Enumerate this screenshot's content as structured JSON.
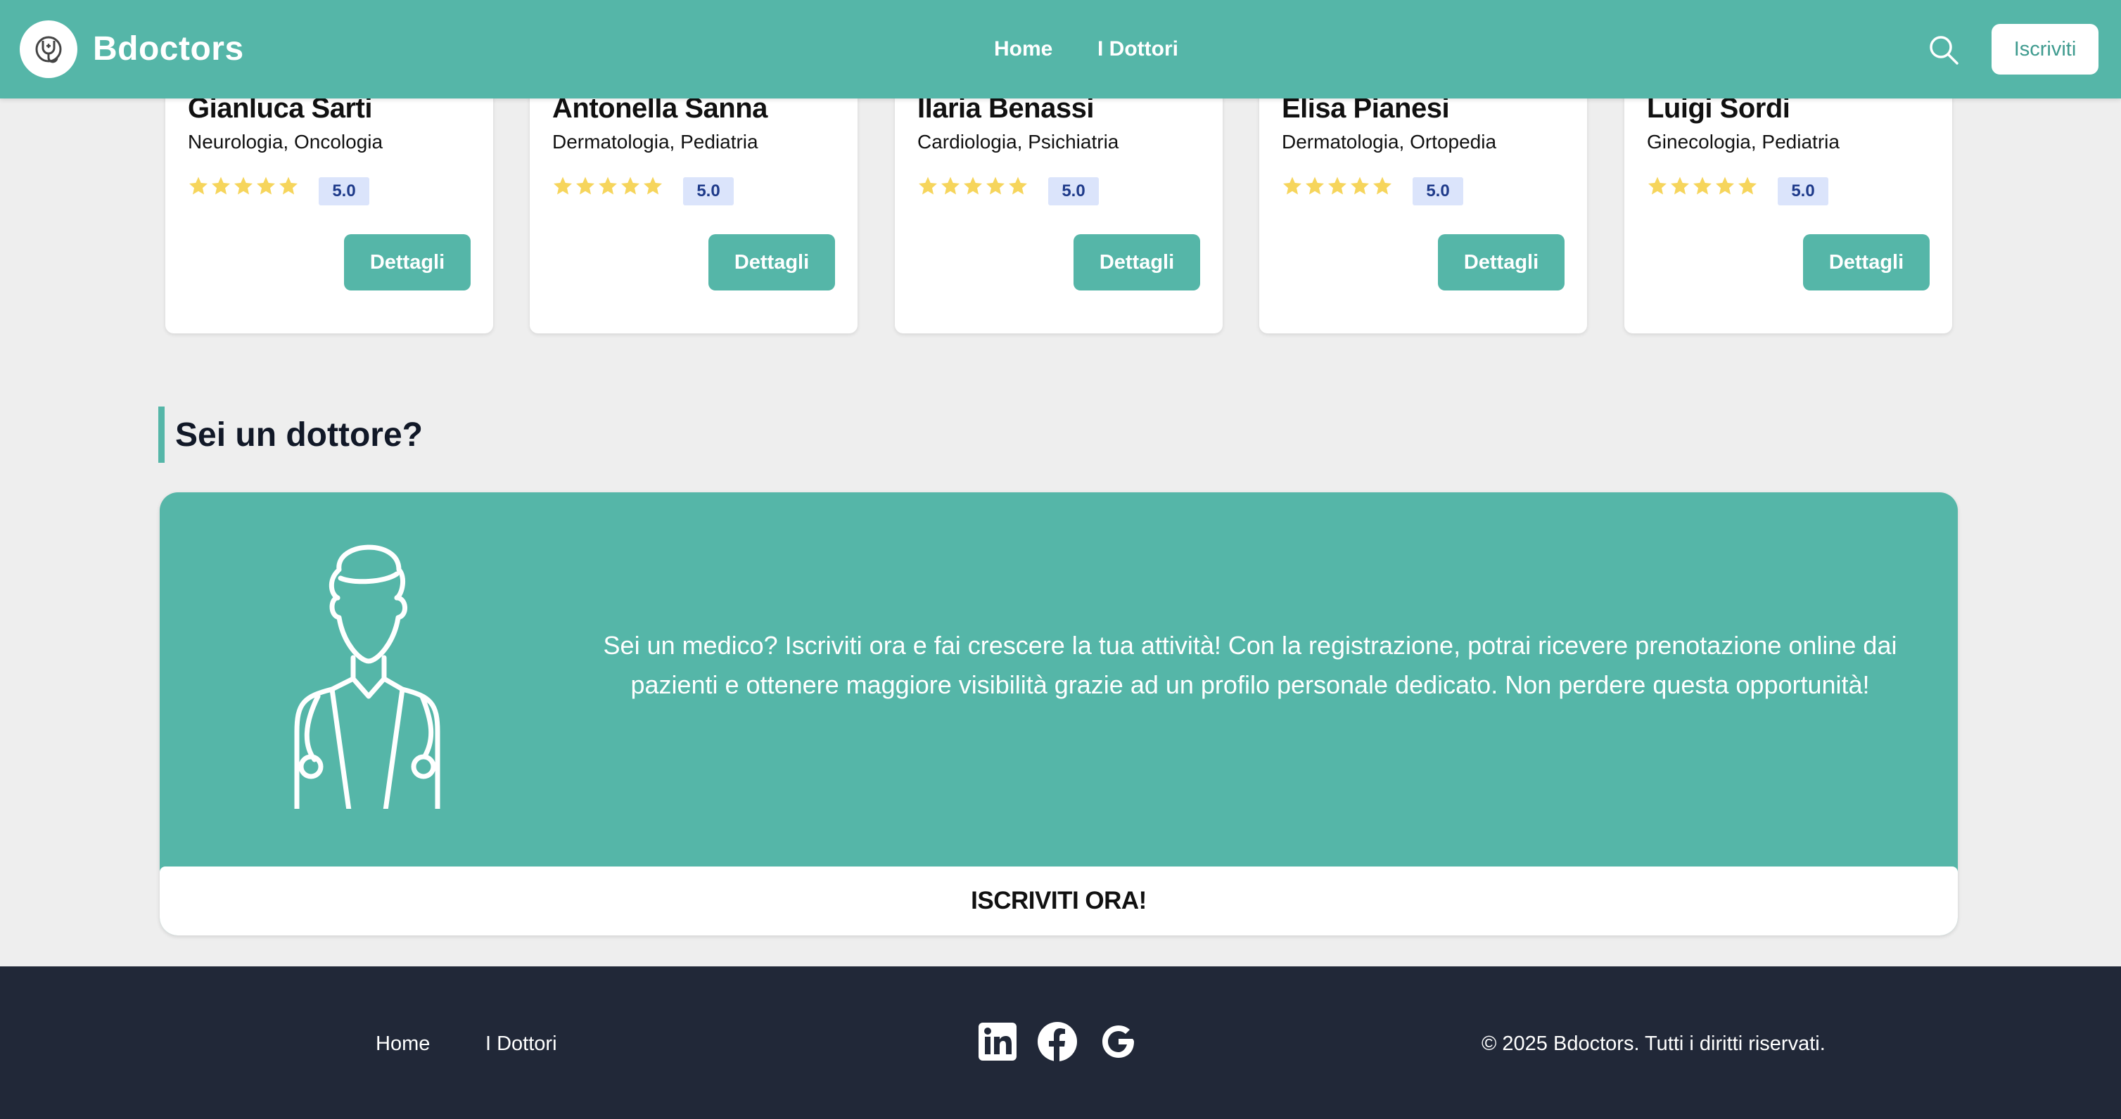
{
  "header": {
    "brand": "Bdoctors",
    "nav": [
      "Home",
      "I Dottori"
    ],
    "signup_label": "Iscriviti"
  },
  "doctors": [
    {
      "name": "Gianluca Sarti",
      "specialties": "Neurologia, Oncologia",
      "rating": "5.0",
      "stars": 5,
      "details_label": "Dettagli"
    },
    {
      "name": "Antonella Sanna",
      "specialties": "Dermatologia, Pediatria",
      "rating": "5.0",
      "stars": 5,
      "details_label": "Dettagli"
    },
    {
      "name": "Ilaria Benassi",
      "specialties": "Cardiologia, Psichiatria",
      "rating": "5.0",
      "stars": 5,
      "details_label": "Dettagli"
    },
    {
      "name": "Elisa Pianesi",
      "specialties": "Dermatologia, Ortopedia",
      "rating": "5.0",
      "stars": 5,
      "details_label": "Dettagli"
    },
    {
      "name": "Luigi Sordi",
      "specialties": "Ginecologia, Pediatria",
      "rating": "5.0",
      "stars": 5,
      "details_label": "Dettagli"
    }
  ],
  "promo": {
    "section_title": "Sei un dottore?",
    "text": "Sei un medico? Iscriviti ora e fai crescere la tua attività! Con la registrazione, potrai ricevere prenotazione online dai pazienti e ottenere maggiore visibilità grazie ad un profilo personale dedicato. Non perdere questa opportunità!",
    "cta_label": "ISCRIVITI ORA!"
  },
  "footer": {
    "links": [
      "Home",
      "I Dottori"
    ],
    "social_icons": [
      "linkedin-icon",
      "facebook-icon",
      "google-icon"
    ],
    "copyright": "© 2025 Bdoctors. Tutti i diritti riservati."
  },
  "colors": {
    "primary": "#55b6a8",
    "footer_bg": "#212838",
    "page_bg": "#eeeeee",
    "star": "#f6d55c",
    "rating_badge_bg": "#dbe4fb"
  }
}
